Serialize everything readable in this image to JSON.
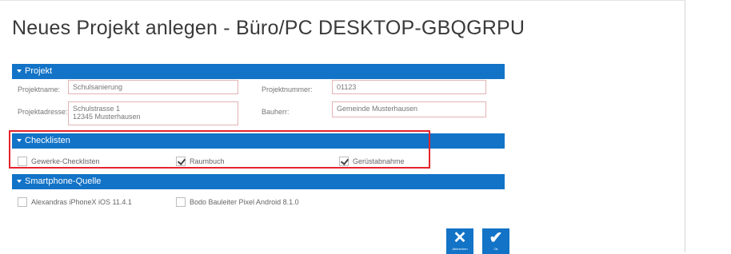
{
  "dialog": {
    "title": "Neues Projekt anlegen - Büro/PC DESKTOP-GBQGRPU"
  },
  "sections": {
    "projekt": {
      "label": "Projekt"
    },
    "checklisten": {
      "label": "Checklisten"
    },
    "smartphone": {
      "label": "Smartphone-Quelle"
    }
  },
  "projekt": {
    "name_label": "Projektname:",
    "name_value": "Schulsanierung",
    "nummer_label": "Projektnummer:",
    "nummer_value": "01123",
    "adresse_label": "Projektadresse:",
    "adresse_line1": "Schulstrasse 1",
    "adresse_line2": "12345 Musterhausen",
    "bauherr_label": "Bauherr:",
    "bauherr_value": "Gemeinde Musterhausen"
  },
  "checklisten": {
    "items": [
      {
        "label": "Gewerke-Checklisten",
        "checked": false
      },
      {
        "label": "Raumbuch",
        "checked": true
      },
      {
        "label": "Gerüstabnahme",
        "checked": true
      }
    ]
  },
  "smartphone": {
    "items": [
      {
        "label": "Alexandras iPhoneX iOS 11.4.1",
        "checked": false
      },
      {
        "label": "Bodo Bauleiter Pixel Android 8.1.0",
        "checked": false
      }
    ]
  },
  "actions": {
    "cancel_caption": "Abbrechen",
    "ok_caption": "Ok"
  },
  "colors": {
    "accent": "#1273c7",
    "highlight": "#e4232b"
  },
  "icons": {
    "section_caret": "caret-down-icon",
    "cancel": "close-icon",
    "ok": "checkmark-icon"
  }
}
